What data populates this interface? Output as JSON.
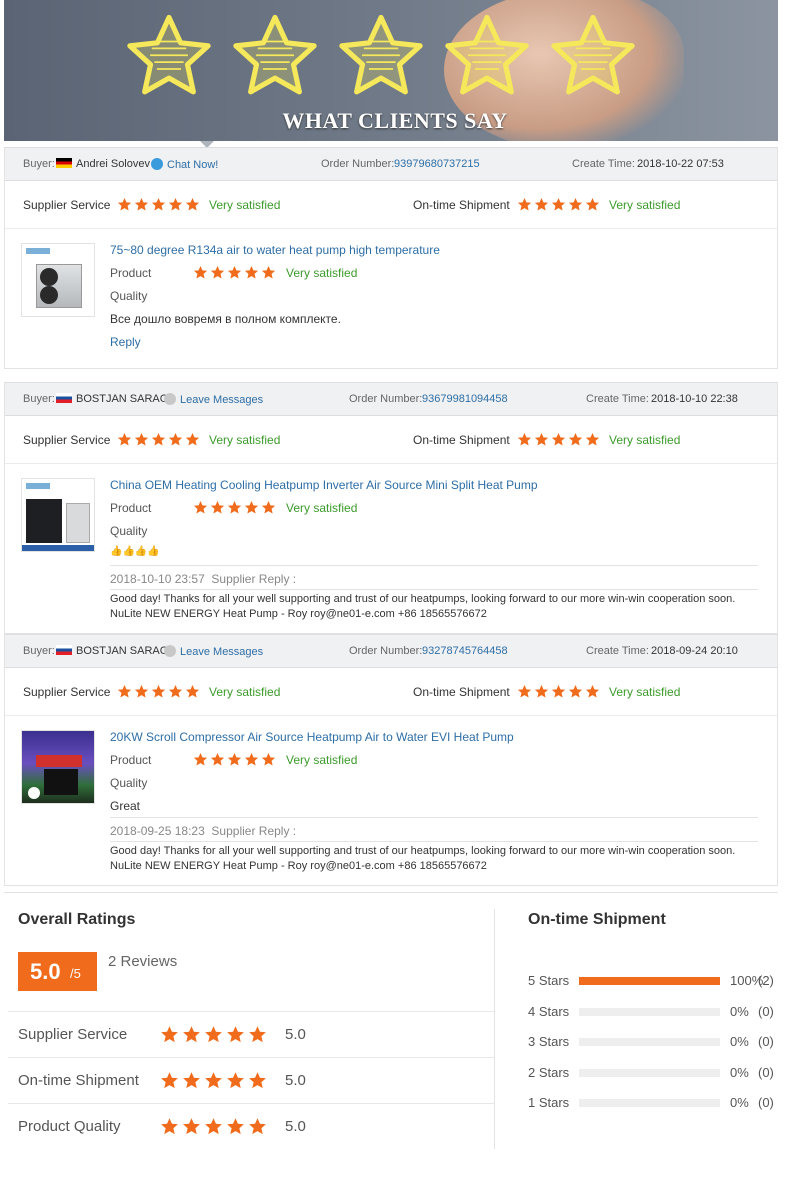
{
  "banner": {
    "title": "WHAT CLIENTS SAY",
    "star_color": "#f5e85a"
  },
  "labels": {
    "buyer": "Buyer:",
    "order_number": "Order Number:",
    "create_time": "Create Time:",
    "supplier_service": "Supplier Service",
    "ontime_shipment": "On-time Shipment",
    "product": "Product",
    "quality": "Quality",
    "supplier_reply": "Supplier Reply :",
    "reply": "Reply"
  },
  "reviews": [
    {
      "buyer": "Andrei Solovev",
      "contact": "Chat Now!",
      "order_number": "93979680737215",
      "create_time": "2018-10-22 07:53",
      "supplier_service": "Very satisfied",
      "ontime_shipment": "Very satisfied",
      "product_title": "75~80 degree R134a air to water heat pump high temperature",
      "product_rating": "Very satisfied",
      "comment": "Все дошло вовремя в полном комплекте.",
      "reply_link": "Reply"
    },
    {
      "buyer": "BOSTJAN SARAC",
      "contact": "Leave Messages",
      "order_number": "93679981094458",
      "create_time": "2018-10-10 22:38",
      "supplier_service": "Very satisfied",
      "ontime_shipment": "Very satisfied",
      "product_title": "China OEM Heating Cooling Heatpump Inverter Air Source Mini Split Heat Pump",
      "product_rating": "Very satisfied",
      "comment": "👍👍👍👍",
      "reply_time": "2018-10-10 23:57",
      "reply_text": "Good day! Thanks for all your well supporting and trust of our heatpumps, looking forward to our more win-win cooperation soon. NuLite NEW ENERGY Heat Pump - Roy roy@ne01-e.com +86 18565576672"
    },
    {
      "buyer": "BOSTJAN SARAC",
      "contact": "Leave Messages",
      "order_number": "93278745764458",
      "create_time": "2018-09-24 20:10",
      "supplier_service": "Very satisfied",
      "ontime_shipment": "Very satisfied",
      "product_title": "20KW Scroll Compressor Air Source Heatpump Air to Water EVI Heat Pump",
      "product_rating": "Very satisfied",
      "comment": "Great",
      "reply_time": "2018-09-25 18:23",
      "reply_text": "Good day! Thanks for all your well supporting and trust of our heatpumps, looking forward to our more win-win cooperation soon. NuLite NEW ENERGY Heat Pump - Roy roy@ne01-e.com +86 18565576672"
    }
  ],
  "overall": {
    "title": "Overall Ratings",
    "score": "5.0",
    "score_suffix": "/5",
    "reviews_count": "2 Reviews",
    "categories": [
      {
        "label": "Supplier Service",
        "value": "5.0"
      },
      {
        "label": "On-time Shipment",
        "value": "5.0"
      },
      {
        "label": "Product Quality",
        "value": "5.0"
      }
    ]
  },
  "shipment": {
    "title": "On-time Shipment",
    "rows": [
      {
        "label": "5 Stars",
        "pct": "100%",
        "count": "(2)",
        "fraction": 1.0
      },
      {
        "label": "4 Stars",
        "pct": "0%",
        "count": "(0)",
        "fraction": 0
      },
      {
        "label": "3 Stars",
        "pct": "0%",
        "count": "(0)",
        "fraction": 0
      },
      {
        "label": "2 Stars",
        "pct": "0%",
        "count": "(0)",
        "fraction": 0
      },
      {
        "label": "1 Stars",
        "pct": "0%",
        "count": "(0)",
        "fraction": 0
      }
    ]
  },
  "colors": {
    "accent": "#f06c1c",
    "link": "#2e6ea6",
    "satisfied": "#3c9b2b"
  }
}
